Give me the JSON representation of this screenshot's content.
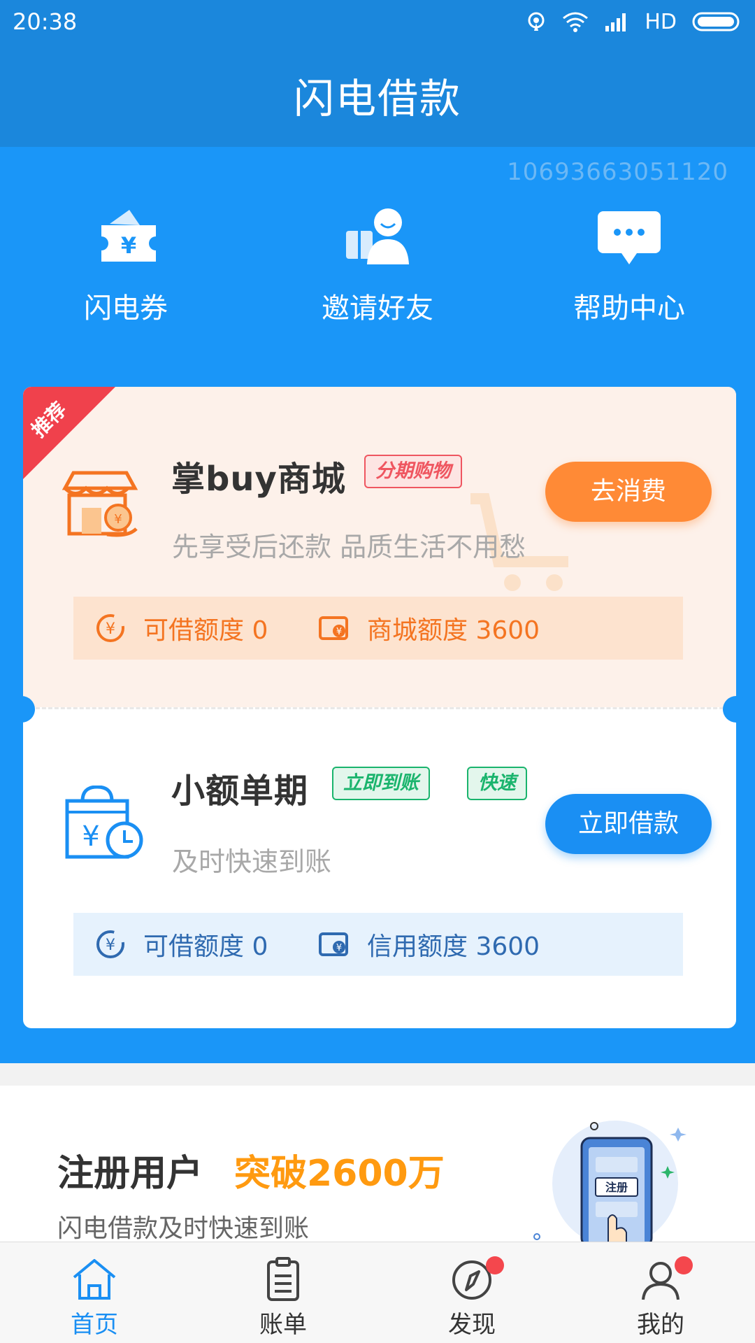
{
  "status_bar": {
    "time": "20:38",
    "network": "HD"
  },
  "app": {
    "title": "闪电借款"
  },
  "user": {
    "id": "10693663051120"
  },
  "quick_nav": [
    {
      "label": "闪电券",
      "icon": "coupon-icon"
    },
    {
      "label": "邀请好友",
      "icon": "invite-friend-icon"
    },
    {
      "label": "帮助中心",
      "icon": "help-chat-icon"
    }
  ],
  "products": [
    {
      "ribbon": "推荐",
      "name": "掌buy商城",
      "tags": [
        "分期购物"
      ],
      "description": "先享受后还款 品质生活不用愁",
      "button": "去消费",
      "quota_left_label": "可借额度 0",
      "quota_right_label": "商城额度 3600"
    },
    {
      "name": "小额单期",
      "tags": [
        "立即到账",
        "快速"
      ],
      "description": "及时快速到账",
      "button": "立即借款",
      "quota_left_label": "可借额度 0",
      "quota_right_label": "信用额度 3600"
    }
  ],
  "promo": {
    "title": "注册用户",
    "highlight": "突破2600万",
    "subtitle": "闪电借款及时快速到账",
    "art_label": "注册"
  },
  "tabs": [
    {
      "label": "首页",
      "icon": "home-icon",
      "active": true
    },
    {
      "label": "账单",
      "icon": "bill-icon",
      "active": false
    },
    {
      "label": "发现",
      "icon": "compass-icon",
      "active": false,
      "badge": true
    },
    {
      "label": "我的",
      "icon": "profile-icon",
      "active": false,
      "badge": true
    }
  ],
  "colors": {
    "header": "#1b87dc",
    "hero": "#1a96f8",
    "orange": "#ff8a36",
    "blue_button": "#1a8ff3",
    "ribbon": "#f0414c",
    "promo_highlight": "#ff9a10"
  }
}
